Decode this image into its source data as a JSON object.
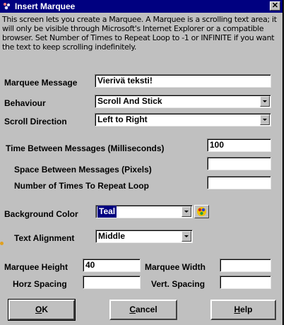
{
  "window": {
    "title": "Insert Marquee",
    "close_label": "✕"
  },
  "description": {
    "lines": [
      "This screen lets you create a Marquee. A Marquee is a scrolling text area; it",
      "will only be visible through Microsoft's Internet Explorer or a compatible",
      "browser. Set Number of Times to Repeat Loop to -1 or INFINITE if you want",
      "the text to keep scrolling indefinitely."
    ]
  },
  "form": {
    "marquee_message": {
      "label": "Marquee Message",
      "value": "Vierivä teksti!"
    },
    "behaviour": {
      "label": "Behaviour",
      "value": "Scroll And Stick"
    },
    "scroll_direction": {
      "label": "Scroll Direction",
      "value": "Left to Right"
    },
    "time_between": {
      "label": "Time Between Messages (Milliseconds)",
      "value": "100"
    },
    "space_between": {
      "label": "Space Between Messages (Pixels)",
      "value": ""
    },
    "repeat_loop": {
      "label": "Number of Times To Repeat Loop",
      "value": ""
    },
    "background_color": {
      "label": "Background Color",
      "value": "Teal"
    },
    "text_alignment": {
      "label": "Text Alignment",
      "value": "Middle"
    },
    "marquee_height": {
      "label": "Marquee Height",
      "value": "40"
    },
    "marquee_width": {
      "label": "Marquee Width",
      "value": ""
    },
    "horz_spacing": {
      "label": "Horz Spacing",
      "value": ""
    },
    "vert_spacing": {
      "label": "Vert. Spacing",
      "value": ""
    }
  },
  "buttons": {
    "ok": {
      "mnemonic": "O",
      "rest": "K"
    },
    "cancel": {
      "mnemonic": "C",
      "rest": "ancel"
    },
    "help": {
      "mnemonic": "H",
      "rest": "elp"
    }
  },
  "colors": {
    "titlebar": "#000080",
    "dialog_face": "#c0c0c0",
    "selection": "#000080"
  },
  "icons": {
    "app": "marquee-app-icon",
    "palette": "color-palette-icon"
  }
}
